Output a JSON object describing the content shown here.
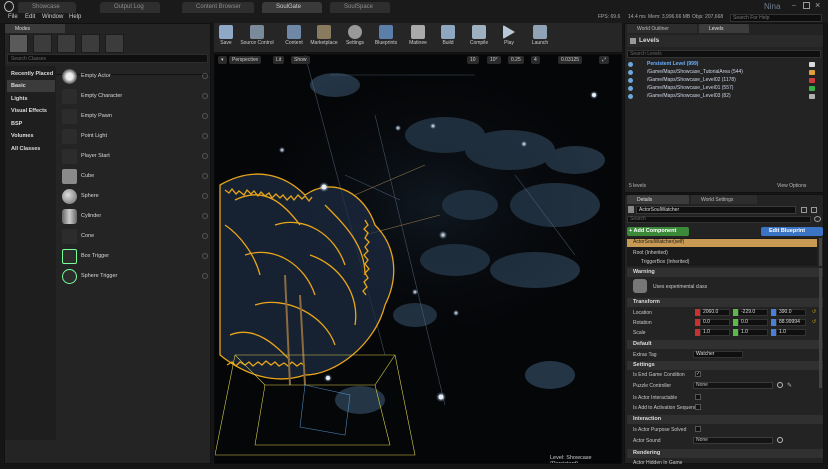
{
  "titlebar": {
    "tabs": [
      "Showcase",
      "Output Log",
      "Content Browser",
      "SoulGate",
      "SoulSpace"
    ],
    "user": "Nina",
    "stats": {
      "fps": "FPS: 69.6",
      "ms": "14.4 ms",
      "mem": "Mem: 3,996.66 MB",
      "objs": "Objs: 207,668"
    },
    "search_help": "Search For Help"
  },
  "menu": [
    "File",
    "Edit",
    "Window",
    "Help"
  ],
  "modes": {
    "tab_label": "Modes",
    "search_placeholder": "Search Classes",
    "categories": [
      "Recently Placed",
      "Basic",
      "Lights",
      "Visual Effects",
      "BSP",
      "Volumes",
      "All Classes"
    ],
    "selected_category": "Basic",
    "assets": [
      "Empty Actor",
      "Empty Character",
      "Empty Pawn",
      "Point Light",
      "Player Start",
      "Cube",
      "Sphere",
      "Cylinder",
      "Cone",
      "Box Trigger",
      "Sphere Trigger"
    ]
  },
  "toolbar": {
    "buttons": [
      "Save",
      "Source Control",
      "Content",
      "Marketplace",
      "Settings",
      "Blueprints",
      "Matinee",
      "Build",
      "Compile",
      "Play",
      "Launch"
    ]
  },
  "viewport": {
    "perspective": "Perspective",
    "lit": "Lit",
    "show": "Show",
    "grid_value": "10",
    "angle_value": "10°",
    "scale_value": "0.25",
    "speed_value": "4",
    "cam_value": "0.03125",
    "level_label": "Level: Showcase (Persistent)"
  },
  "outliner": {
    "tab_world": "World Outliner",
    "tab_levels": "Levels",
    "header": "Levels",
    "search_placeholder": "Search Levels",
    "rows": [
      {
        "name": "Persistent Level (999)",
        "color": "#d9d9d9"
      },
      {
        "name": "/Game/Maps/Showcase_TutorialArea (544)",
        "color": "#e0a03a"
      },
      {
        "name": "/Game/Maps/Showcase_Level02 (1178)",
        "color": "#d03a3a"
      },
      {
        "name": "/Game/Maps/Showcase_Level01 (557)",
        "color": "#3ab04a"
      },
      {
        "name": "/Game/Maps/Showcase_Level03 (82)",
        "color": "#b0b0b0"
      }
    ],
    "count": "5 levels",
    "view_options": "View Options"
  },
  "details": {
    "tab_details": "Details",
    "tab_world_settings": "World Settings",
    "actor_name": "ActorSoulWatcher",
    "search_placeholder": "Search",
    "add_component": "+ Add Component",
    "edit_blueprint": "Edit Blueprint",
    "self_row": "ActorSoulWatcher(self)",
    "root_row": "Root (Inherited)",
    "trigger_row": "TriggerBox (Inherited)",
    "warning_section": "Warning",
    "warning_text": "Uses experimental class",
    "transform_section": "Transform",
    "location_label": "Location",
    "location": [
      "2060.0",
      "-229.0",
      "390.0"
    ],
    "rotation_label": "Rotation",
    "rotation": [
      "0.0",
      "0.0",
      "88.99994"
    ],
    "scale_label": "Scale",
    "scale": [
      "1.0",
      "1.0",
      "1.0"
    ],
    "default_section": "Default",
    "extras_tag_label": "Extras Tag",
    "extras_tag_value": "Watcher",
    "settings_section": "Settings",
    "end_game_label": "Is End Game Condition",
    "puzzle_label": "Puzzle Controller",
    "puzzle_value": "None",
    "interactable_label": "Is Actor Interactable",
    "activation_label": "Is Add to Activation Sequence",
    "interaction_section": "Interaction",
    "purpose_label": "Is Actor Purpose Solved",
    "sound_label": "Actor Sound",
    "sound_value": "None",
    "rendering_section": "Rendering",
    "hidden_label": "Actor Hidden In Game"
  }
}
